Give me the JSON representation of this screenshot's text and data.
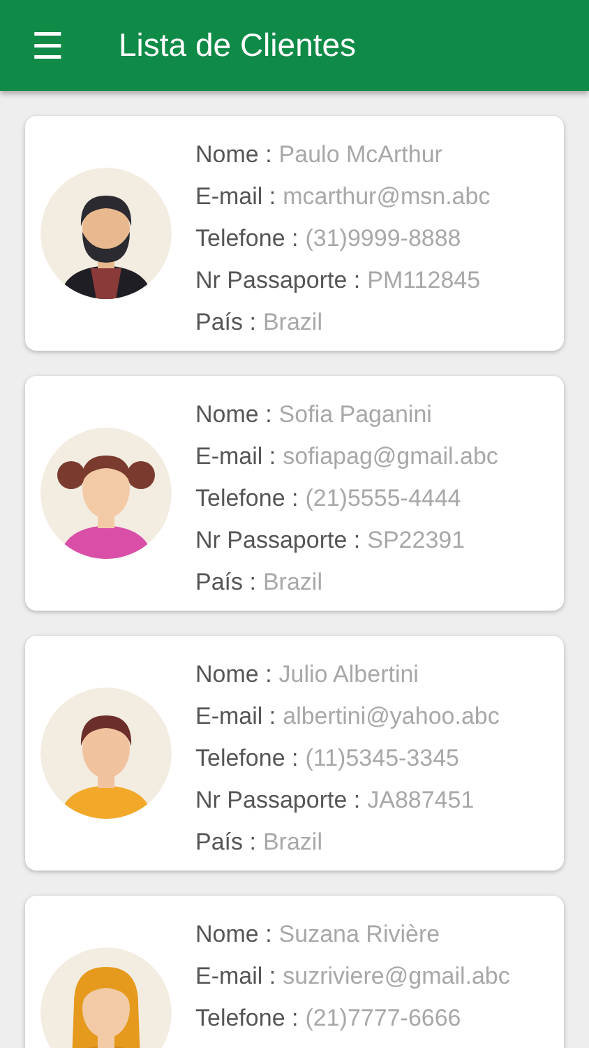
{
  "app_bar": {
    "menu_icon": "☰",
    "title": "Lista de Clientes"
  },
  "clients": [
    {
      "fields": [
        {
          "label": "Nome :",
          "value": "Paulo McArthur"
        },
        {
          "label": "E-mail :",
          "value": "mcarthur@msn.abc"
        },
        {
          "label": "Telefone :",
          "value": "(31)9999-8888"
        },
        {
          "label": "Nr Passaporte :",
          "value": "PM112845"
        },
        {
          "label": "País :",
          "value": "Brazil"
        }
      ]
    },
    {
      "fields": [
        {
          "label": "Nome :",
          "value": "Sofia Paganini"
        },
        {
          "label": "E-mail :",
          "value": "sofiapag@gmail.abc"
        },
        {
          "label": "Telefone :",
          "value": "(21)5555-4444"
        },
        {
          "label": "Nr Passaporte :",
          "value": "SP22391"
        },
        {
          "label": "País :",
          "value": "Brazil"
        }
      ]
    },
    {
      "fields": [
        {
          "label": "Nome :",
          "value": "Julio Albertini"
        },
        {
          "label": "E-mail :",
          "value": "albertini@yahoo.abc"
        },
        {
          "label": "Telefone :",
          "value": "(11)5345-3345"
        },
        {
          "label": "Nr Passaporte :",
          "value": "JA887451"
        },
        {
          "label": "País :",
          "value": "Brazil"
        }
      ]
    },
    {
      "fields": [
        {
          "label": "Nome :",
          "value": "Suzana Rivière"
        },
        {
          "label": "E-mail :",
          "value": "suzriviere@gmail.abc"
        },
        {
          "label": "Telefone :",
          "value": "(21)7777-6666"
        }
      ]
    }
  ]
}
